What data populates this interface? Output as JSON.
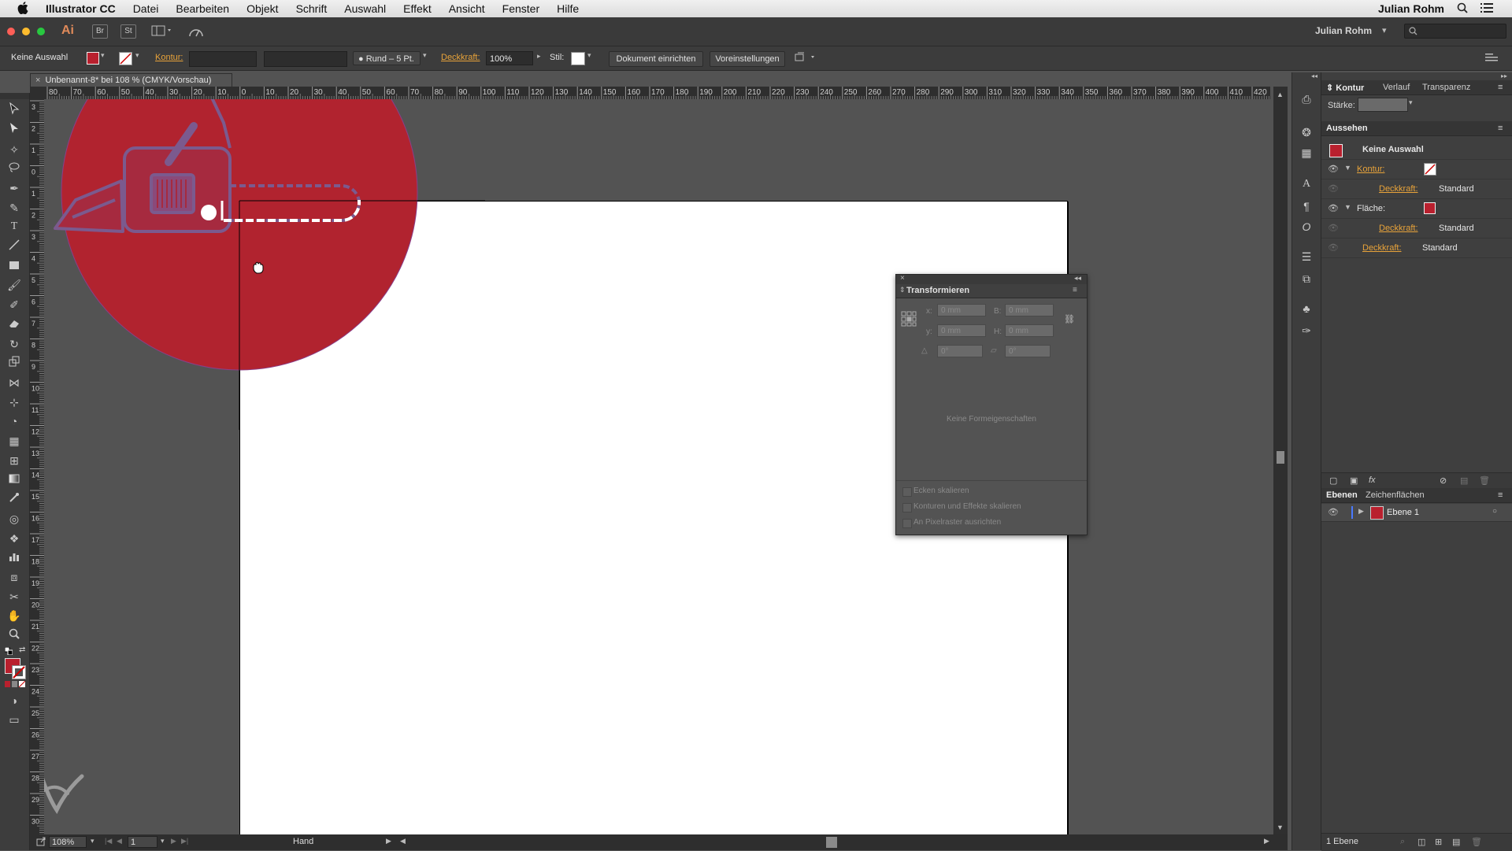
{
  "menubar": {
    "apple": "",
    "items": [
      "Illustrator CC",
      "Datei",
      "Bearbeiten",
      "Objekt",
      "Schrift",
      "Auswahl",
      "Effekt",
      "Ansicht",
      "Fenster",
      "Hilfe"
    ],
    "user": "Julian Rohm"
  },
  "appbar": {
    "app_icon": "Ai",
    "br": "Br",
    "st": "St",
    "user": "Julian Rohm"
  },
  "control": {
    "selection": "Keine Auswahl",
    "kontur_label": "Kontur:",
    "brush": "Rund – 5 Pt.",
    "deckkraft_label": "Deckkraft:",
    "deckkraft_value": "100%",
    "stil_label": "Stil:",
    "doc_setup": "Dokument einrichten",
    "prefs": "Voreinstellungen"
  },
  "document": {
    "tab_title": "Unbenannt-8* bei 108 % (CMYK/Vorschau)",
    "ruler_h": [
      "80",
      "70",
      "60",
      "50",
      "40",
      "30",
      "20",
      "10",
      "0",
      "10",
      "20",
      "30",
      "40",
      "50",
      "60",
      "70",
      "80",
      "90",
      "100",
      "110",
      "120",
      "130",
      "140",
      "150",
      "160",
      "170",
      "180",
      "190",
      "200",
      "210",
      "220",
      "230",
      "240",
      "250",
      "260",
      "270",
      "280",
      "290",
      "300",
      "310",
      "320",
      "330",
      "340",
      "350",
      "360",
      "370",
      "380",
      "390",
      "400",
      "410",
      "420"
    ],
    "ruler_v": [
      "3",
      "2",
      "1",
      "0",
      "1",
      "2",
      "3",
      "4",
      "5",
      "6",
      "7",
      "8",
      "9",
      "10",
      "11",
      "12",
      "13",
      "14",
      "15",
      "16",
      "17",
      "18",
      "19",
      "20",
      "21",
      "22",
      "23",
      "24",
      "25",
      "26",
      "27",
      "28",
      "29",
      "30"
    ]
  },
  "status": {
    "zoom": "108%",
    "page": "1",
    "tool": "Hand"
  },
  "transform_panel": {
    "title": "Transformieren",
    "x_label": "x:",
    "x_value": "0 mm",
    "b_label": "B:",
    "b_value": "0 mm",
    "y_label": "y:",
    "y_value": "0 mm",
    "h_label": "H:",
    "h_value": "0 mm",
    "rot_value": "0°",
    "shear_value": "0°",
    "no_shape": "Keine Formeigenschaften",
    "opt1": "Ecken skalieren",
    "opt2": "Konturen und Effekte skalieren",
    "opt3": "An Pixelraster ausrichten"
  },
  "panels": {
    "tabs1": [
      "Kontur",
      "Verlauf",
      "Transparenz"
    ],
    "staerke_label": "Stärke:",
    "aussehen_title": "Aussehen",
    "aussehen_selection": "Keine Auswahl",
    "kontur": "Kontur:",
    "deckkraft": "Deckkraft:",
    "standard": "Standard",
    "flaeche": "Fläche:",
    "tabs2": [
      "Ebenen",
      "Zeichenflächen"
    ],
    "layer_name": "Ebene 1",
    "layer_count": "1 Ebene"
  },
  "colors": {
    "accent_red": "#b9202e",
    "orange_label": "#e8a33a"
  }
}
